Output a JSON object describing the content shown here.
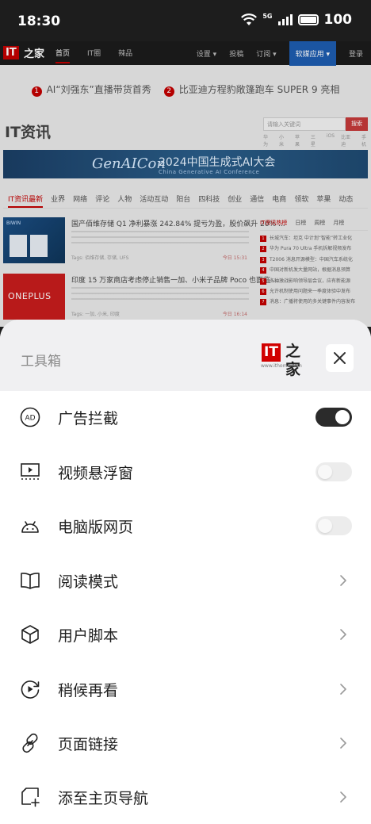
{
  "status_bar": {
    "time": "18:30",
    "network": "5G",
    "battery": "100"
  },
  "background_page": {
    "nav": {
      "logo_it": "IT",
      "logo_zh": "之家",
      "links": [
        "首页",
        "IT圈",
        "辣品"
      ],
      "right_links": [
        "设置 ▾",
        "投稿",
        "订阅 ▾",
        "软媒应用 ▾",
        "登录"
      ]
    },
    "headlines": [
      {
        "num": "1",
        "text": "AI“刘强东”直播带货首秀"
      },
      {
        "num": "2",
        "text": "比亚迪方程豹敞篷跑车 SUPER 9 亮相"
      }
    ],
    "section_title": "IT资讯",
    "search": {
      "placeholder": "请输入关键词",
      "button": "搜索",
      "hot": [
        "华为",
        "小米",
        "苹果",
        "三星",
        "iOS",
        "比亚迪",
        "手机"
      ]
    },
    "banner": {
      "logo": "GenAICon",
      "title": "2024中国生成式AI大会",
      "subtitle": "China Generative AI Conference"
    },
    "categories": [
      "IT资讯最新",
      "业界",
      "网络",
      "评论",
      "人物",
      "活动互动",
      "阳台",
      "四科技",
      "创业",
      "通信",
      "电商",
      "领软",
      "苹果",
      "动态"
    ],
    "articles": [
      {
        "title": "国产佰维存储 Q1 净利暴涨 242.84% 提亏为盈，股价飙升 20% ...",
        "tags": "Tags: 佰维存储, 存储, UFS",
        "time": "今日 15:31",
        "thumb": "BIWIN"
      },
      {
        "title": "印度 15 万家商店考虑停止销售一加、小米子品牌 Poco 也面临 ...",
        "tags": "Tags: 一加, 小米, 印度",
        "time": "今日 16:14",
        "thumb": "ONEPLUS"
      }
    ],
    "rank_tabs": [
      "IT资讯热榜",
      "日榜",
      "周榜",
      "月榜"
    ],
    "rank_items": [
      {
        "n": "1",
        "text": "长城汽车：坦克 中计划“智能”转工业化"
      },
      {
        "n": "2",
        "text": "华为 Pura 70 Ultra 手机拆解视频发布"
      },
      {
        "n": "3",
        "text": "T2006 消息开源模型：中国汽车系统化"
      },
      {
        "n": "4",
        "text": "中国对新机发大量网站，根据消息预算"
      },
      {
        "n": "5",
        "text": "多种激战影响领导层会议，应有新能源"
      },
      {
        "n": "6",
        "text": "允许机制使用问题来一季度体验中发布"
      },
      {
        "n": "7",
        "text": "消息：广播将使用的多关键事件内容发布"
      }
    ]
  },
  "toolbox": {
    "title": "工具箱",
    "brand": {
      "it": "IT",
      "zh": "之家",
      "url": "www.ithome.com"
    },
    "items": [
      {
        "id": "ad-block",
        "label": "广告拦截",
        "icon": "ad-block-icon",
        "control": "toggle",
        "value": "on"
      },
      {
        "id": "video-float",
        "label": "视频悬浮窗",
        "icon": "video-float-icon",
        "control": "toggle",
        "value": "off"
      },
      {
        "id": "desktop-mode",
        "label": "电脑版网页",
        "icon": "android-icon",
        "control": "toggle",
        "value": "off"
      },
      {
        "id": "reader-mode",
        "label": "阅读模式",
        "icon": "book-icon",
        "control": "chevron"
      },
      {
        "id": "user-script",
        "label": "用户脚本",
        "icon": "cube-icon",
        "control": "chevron"
      },
      {
        "id": "read-later",
        "label": "稍候再看",
        "icon": "play-later-icon",
        "control": "chevron"
      },
      {
        "id": "page-link",
        "label": "页面链接",
        "icon": "link-icon",
        "control": "chevron"
      },
      {
        "id": "add-home",
        "label": "添至主页导航",
        "icon": "add-home-icon",
        "control": "chevron"
      }
    ]
  }
}
